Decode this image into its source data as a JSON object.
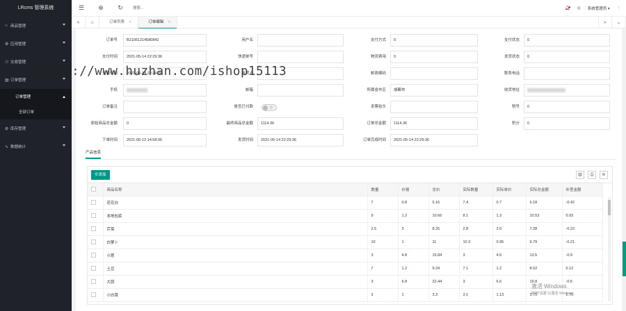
{
  "app": {
    "title": "LRcms 管理系统"
  },
  "sidebar": {
    "items": [
      {
        "icon": "⌂",
        "label": "商品管理"
      },
      {
        "icon": "⚙",
        "label": "应用管理"
      },
      {
        "icon": "⚇",
        "label": "交易管理"
      },
      {
        "icon": "▤",
        "label": "订单管理"
      }
    ],
    "submenu_label": "订单管理",
    "submenu_child": "全部订单",
    "items_after": [
      {
        "icon": "⊛",
        "label": "库存管理"
      },
      {
        "icon": "∿",
        "label": "数据统计"
      }
    ]
  },
  "topbar": {
    "menu_icon": "☰",
    "globe_icon": "⊕",
    "refresh_icon": "↻",
    "search_placeholder": "搜索...",
    "user": "系统管理员 ▾",
    "more": "⋮"
  },
  "tabs": [
    {
      "label": "订单列表"
    },
    {
      "label": "订单编辑"
    }
  ],
  "form": {
    "rows": [
      [
        {
          "label": "订单号",
          "value": "B21051214580842"
        },
        {
          "label": "用户名",
          "value": ""
        },
        {
          "label": "支付方式",
          "value": "0"
        },
        {
          "label": "支付状态",
          "value": "0"
        }
      ],
      [
        {
          "label": "支付时间",
          "value": "2021-05-14 22:29:36"
        },
        {
          "label": "快递单号",
          "value": ""
        },
        {
          "label": "物流费用",
          "value": "0"
        },
        {
          "label": "发货状态",
          "value": "0"
        }
      ],
      [
        {
          "label": "交易时间",
          "value": "2021-05-14 22:29:36"
        },
        {
          "label": "收货人",
          "value": ""
        },
        {
          "label": "邮政编码",
          "value": ""
        },
        {
          "label": "联系电话",
          "value": ""
        }
      ],
      [
        {
          "label": "手机",
          "value": ""
        },
        {
          "label": "邮箱",
          "value": ""
        },
        {
          "label": "所属省市区",
          "value": "成都市"
        },
        {
          "label": "收货地址",
          "value": ""
        }
      ],
      [
        {
          "label": "订单备注",
          "value": ""
        },
        {
          "label": "是否已付款",
          "value": ""
        },
        {
          "label": "发票抬头",
          "value": ""
        },
        {
          "label": "税号",
          "value": "0"
        }
      ],
      [
        {
          "label": "原始商品总金额",
          "value": "0"
        },
        {
          "label": "最终商品总金额",
          "value": "1114.36"
        },
        {
          "label": "订单总金额",
          "value": "1114.36"
        },
        {
          "label": "积分",
          "value": "0"
        }
      ],
      [
        {
          "label": "下单时间",
          "value": "2021-05-12 14:58:06"
        },
        {
          "label": "发货时间",
          "value": "2021-05-14 22:29:36"
        },
        {
          "label": "订单完成时间",
          "value": "2021-05-14 22:29:36"
        }
      ]
    ],
    "switch_label": "否"
  },
  "section_tab": "产品信息",
  "grid": {
    "add_label": "添加",
    "tool_icons": [
      "▥",
      "⎙",
      "⊖"
    ],
    "columns": [
      "商品名称",
      "数量",
      "价格",
      "总价",
      "实际数量",
      "实际单价",
      "实际总金额",
      "补差金额"
    ],
    "rows": [
      [
        "花花白",
        "7",
        "0.8",
        "5.16",
        "7.4",
        "0.7",
        "5.18",
        "-0.42"
      ],
      [
        "本地包浆",
        "9",
        "1.2",
        "10.66",
        "8.1",
        "1.3",
        "10.53",
        "0.93"
      ],
      [
        "芹菜",
        "2.5",
        "3",
        "8.25",
        "2.8",
        "2.6",
        "7.28",
        "-0.22"
      ],
      [
        "白萝卜",
        "10",
        "1",
        "11",
        "10.3",
        "0.95",
        "9.79",
        "-0.21"
      ],
      [
        "小葱",
        "3",
        "4.8",
        "15.84",
        "3",
        "4.5",
        "13.5",
        "-0.9"
      ],
      [
        "土豆",
        "7",
        "1.2",
        "9.24",
        "7.1",
        "1.2",
        "8.52",
        "0.12"
      ],
      [
        "大蒜",
        "3",
        "6.8",
        "22.44",
        "3",
        "6.6",
        "19.8",
        "-0.6"
      ],
      [
        "小白菜",
        "3",
        "1",
        "3.3",
        "3.1",
        "1.13",
        "3.75",
        "2.75"
      ]
    ]
  },
  "watermark": "https://www.huzhan.com/ishop15113",
  "activation": {
    "line1": "激活 Windows",
    "line2": "转到\"设置\"以激活 Windows。"
  }
}
